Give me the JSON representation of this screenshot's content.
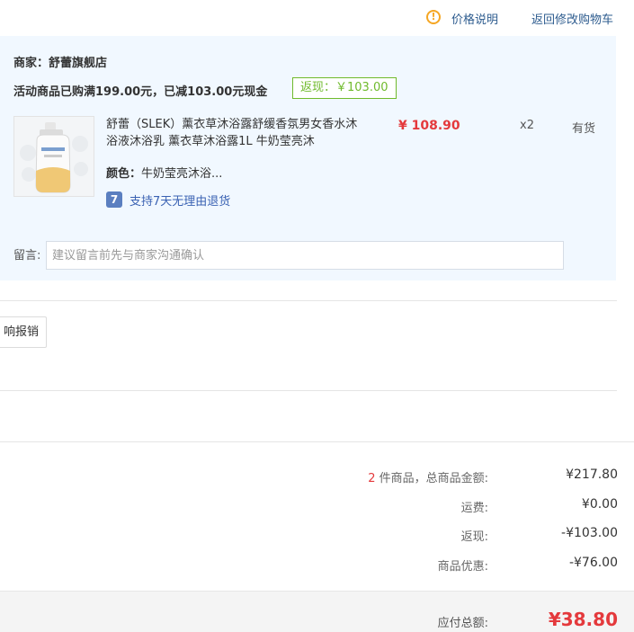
{
  "header": {
    "price_explain": "价格说明",
    "back_to_cart": "返回修改购物车"
  },
  "shop": {
    "label": "商家：",
    "name": "舒蕾旗舰店"
  },
  "promotion": {
    "text": "活动商品已购满199.00元，已减103.00元现金",
    "cashback": "返现：￥103.00"
  },
  "product": {
    "name": "舒蕾（SLEK）薰衣草沐浴露舒缓香氛男女香水沐浴液沐浴乳 薰衣草沐浴露1L 牛奶莹亮沐",
    "color_label": "颜色：",
    "color_value": "牛奶莹亮沐浴...",
    "price": "¥ 108.90",
    "quantity": "x2",
    "stock": "有货",
    "return_icon": "7",
    "return_policy": "支持7天无理由退货"
  },
  "message": {
    "label": "留言:",
    "placeholder": "建议留言前先与商家沟通确认"
  },
  "invoice": {
    "button_label": "响报销"
  },
  "summary": {
    "count": "2",
    "count_label": " 件商品，总商品金额:",
    "goods_total": "¥217.80",
    "shipping_label": "运费:",
    "shipping": "¥0.00",
    "cashback_label": "返现:",
    "cashback": "-¥103.00",
    "discount_label": "商品优惠:",
    "discount": "-¥76.00",
    "payable_label": "应付总额:",
    "payable": "¥38.80"
  },
  "colors": {
    "accent_red": "#e4393c",
    "link_blue": "#2e5c8f",
    "panel_bg": "#f1f8ff",
    "cashback_green": "#6fba2c"
  }
}
